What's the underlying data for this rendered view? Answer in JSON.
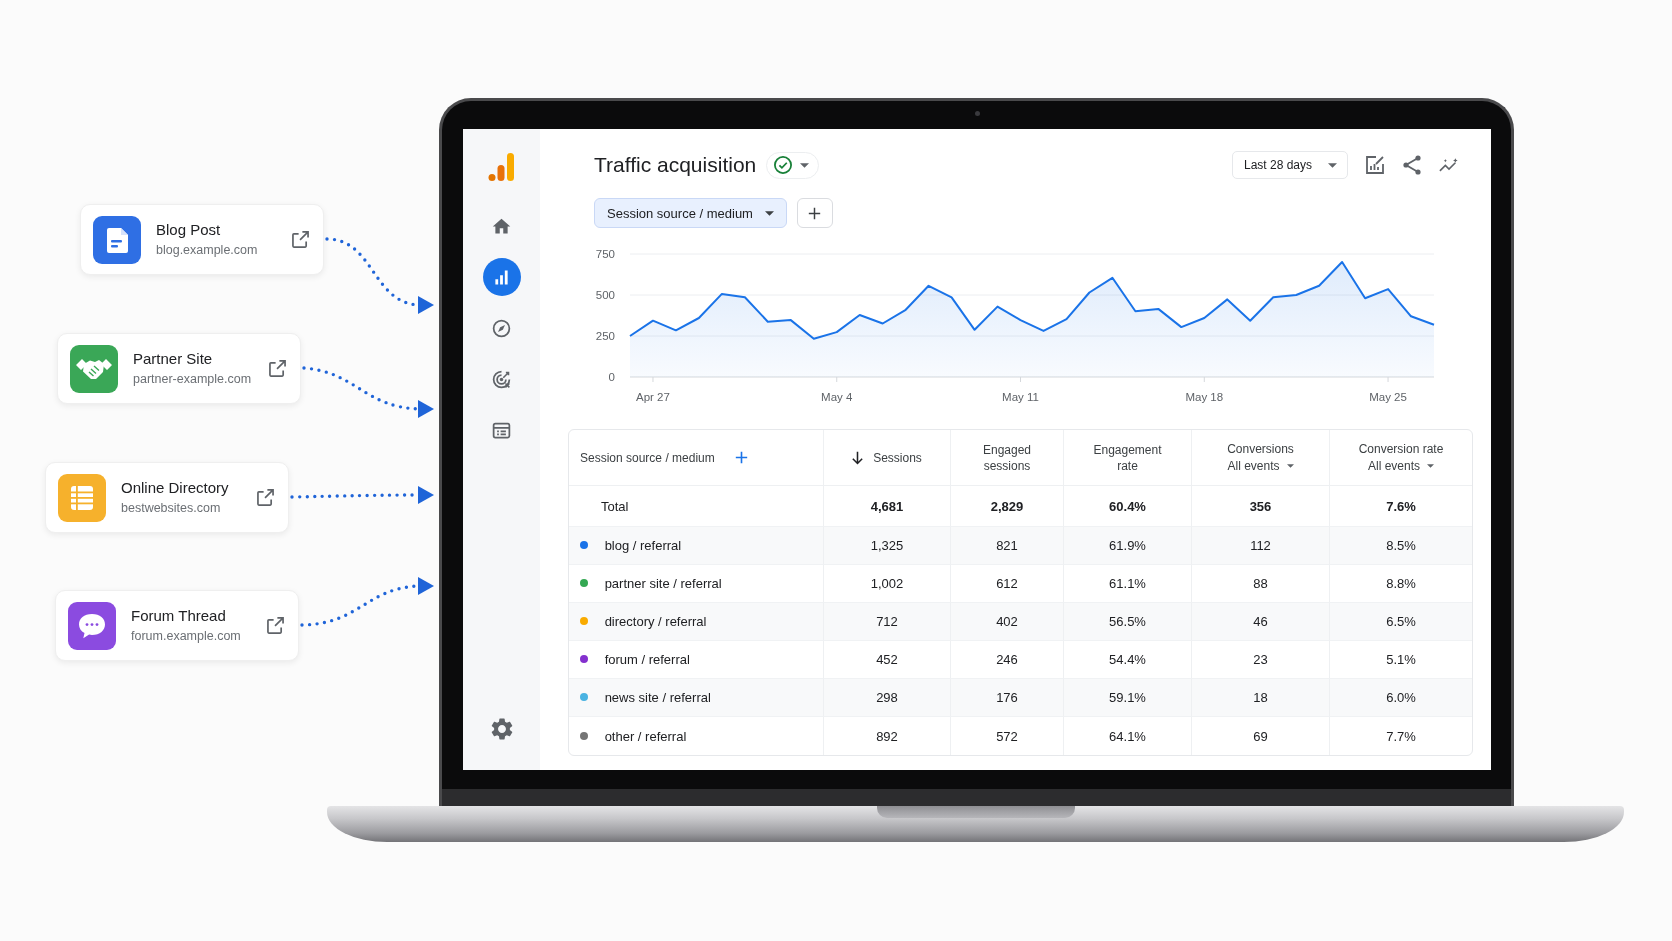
{
  "sources": [
    {
      "kind": "document",
      "title": "Blog Post",
      "url": "blog.example.com",
      "color": "#2f6fe4"
    },
    {
      "kind": "handshake",
      "title": "Partner Site",
      "url": "partner-example.com",
      "color": "#3aa757"
    },
    {
      "kind": "list",
      "title": "Online Directory",
      "url": "bestwebsites.com",
      "color": "#f6b12c"
    },
    {
      "kind": "chat",
      "title": "Forum Thread",
      "url": "forum.example.com",
      "color": "#8b4be0"
    }
  ],
  "app": {
    "nav": [
      {
        "kind": "home",
        "selected": false
      },
      {
        "kind": "reports",
        "selected": true
      },
      {
        "kind": "explore",
        "selected": false
      },
      {
        "kind": "advertising",
        "selected": false
      },
      {
        "kind": "configure",
        "selected": false
      }
    ]
  },
  "page": {
    "title": "Traffic acquisition",
    "date_range": "Last 28 days",
    "dimension_chip": "Session source / medium",
    "chart_data": {
      "type": "area",
      "categories": [
        null,
        "Apr 27",
        null,
        null,
        null,
        null,
        null,
        null,
        null,
        "May 4",
        null,
        null,
        null,
        null,
        null,
        null,
        null,
        "May 11",
        null,
        null,
        null,
        null,
        null,
        null,
        null,
        "May 18",
        null,
        null,
        null,
        null,
        null,
        null,
        null,
        "May 25",
        null,
        null
      ],
      "values": [
        250,
        343,
        285,
        360,
        507,
        486,
        337,
        347,
        233,
        274,
        378,
        326,
        410,
        556,
        486,
        288,
        429,
        347,
        281,
        353,
        515,
        605,
        401,
        415,
        304,
        360,
        473,
        343,
        486,
        500,
        556,
        701,
        480,
        536,
        370,
        318
      ],
      "ylim": [
        0,
        750
      ],
      "yticks": [
        0,
        250,
        500,
        750
      ]
    }
  },
  "table": {
    "columns": [
      {
        "label": "Session source / medium",
        "sorted": false
      },
      {
        "label": "Sessions",
        "sorted": true
      },
      {
        "label": "Engaged sessions",
        "sorted": false
      },
      {
        "label": "Engagement rate",
        "sorted": false
      },
      {
        "label": "Conversions",
        "sublabel": "All events",
        "sorted": false
      },
      {
        "label": "Conversion rate",
        "sublabel": "All events",
        "sorted": false
      }
    ],
    "total": {
      "label": "Total",
      "values": [
        "4,681",
        "2,829",
        "60.4%",
        "356",
        "7.6%"
      ]
    },
    "rows": [
      {
        "label": "blog / referral",
        "color": "#1a73e8",
        "values": [
          "1,325",
          "821",
          "61.9%",
          "112",
          "8.5%"
        ]
      },
      {
        "label": "partner site / referral",
        "color": "#34a853",
        "values": [
          "1,002",
          "612",
          "61.1%",
          "88",
          "8.8%"
        ]
      },
      {
        "label": "directory / referral",
        "color": "#f9ab00",
        "values": [
          "712",
          "402",
          "56.5%",
          "46",
          "6.5%"
        ]
      },
      {
        "label": "forum / referral",
        "color": "#8430ce",
        "values": [
          "452",
          "246",
          "54.4%",
          "23",
          "5.1%"
        ]
      },
      {
        "label": "news site / referral",
        "color": "#4ab3e2",
        "values": [
          "298",
          "176",
          "59.1%",
          "18",
          "6.0%"
        ]
      },
      {
        "label": "other / referral",
        "color": "#757575",
        "values": [
          "892",
          "572",
          "64.1%",
          "69",
          "7.7%"
        ]
      }
    ]
  }
}
